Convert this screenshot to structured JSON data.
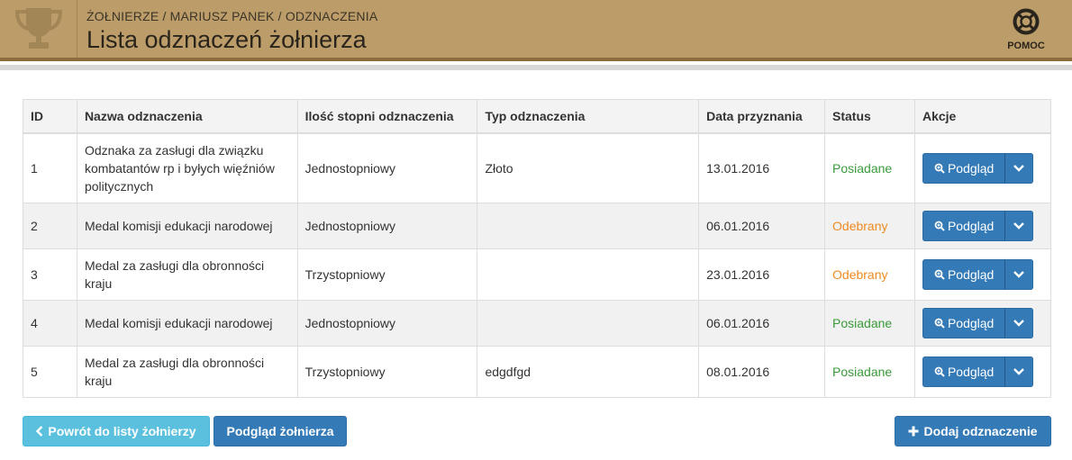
{
  "header": {
    "breadcrumb": "ŻOŁNIERZE / MARIUSZ PANEK / ODZNACZENIA",
    "title": "Lista odznaczeń żołnierza",
    "help_label": "POMOC"
  },
  "table": {
    "columns": [
      "ID",
      "Nazwa odznaczenia",
      "Ilość stopni odznaczenia",
      "Typ odznaczenia",
      "Data przyznania",
      "Status",
      "Akcje"
    ],
    "rows": [
      {
        "id": "1",
        "name": "Odznaka za zasługi dla związku kombatantów rp i byłych więźniów politycznych",
        "degrees": "Jednostopniowy",
        "type": "Złoto",
        "date": "13.01.2016",
        "status": "Posiadane",
        "action": "Podgląd"
      },
      {
        "id": "2",
        "name": "Medal komisji edukacji narodowej",
        "degrees": "Jednostopniowy",
        "type": "",
        "date": "06.01.2016",
        "status": "Odebrany",
        "action": "Podgląd"
      },
      {
        "id": "3",
        "name": "Medal za zasługi dla obronności kraju",
        "degrees": "Trzystopniowy",
        "type": "",
        "date": "23.01.2016",
        "status": "Odebrany",
        "action": "Podgląd"
      },
      {
        "id": "4",
        "name": "Medal komisji edukacji narodowej",
        "degrees": "Jednostopniowy",
        "type": "",
        "date": "06.01.2016",
        "status": "Posiadane",
        "action": "Podgląd"
      },
      {
        "id": "5",
        "name": "Medal za zasługi dla obronności kraju",
        "degrees": "Trzystopniowy",
        "type": "edgdfgd",
        "date": "08.01.2016",
        "status": "Posiadane",
        "action": "Podgląd"
      }
    ]
  },
  "footer": {
    "back_label": "Powrót do listy żołnierzy",
    "view_label": "Podgląd żołnierza",
    "add_label": "Dodaj odznaczenie"
  },
  "colors": {
    "header_bg": "#bc9c69",
    "primary": "#337ab7",
    "info": "#5bc0de",
    "status_posiadane": "#3a9b3a",
    "status_odebrany": "#ee8b22"
  },
  "icons": {
    "header": "trophy-icon",
    "help": "lifebuoy-icon",
    "row_action": "zoom-icon",
    "row_dropdown": "chevron-down-icon",
    "back": "chevron-left-icon",
    "add": "plus-icon"
  }
}
